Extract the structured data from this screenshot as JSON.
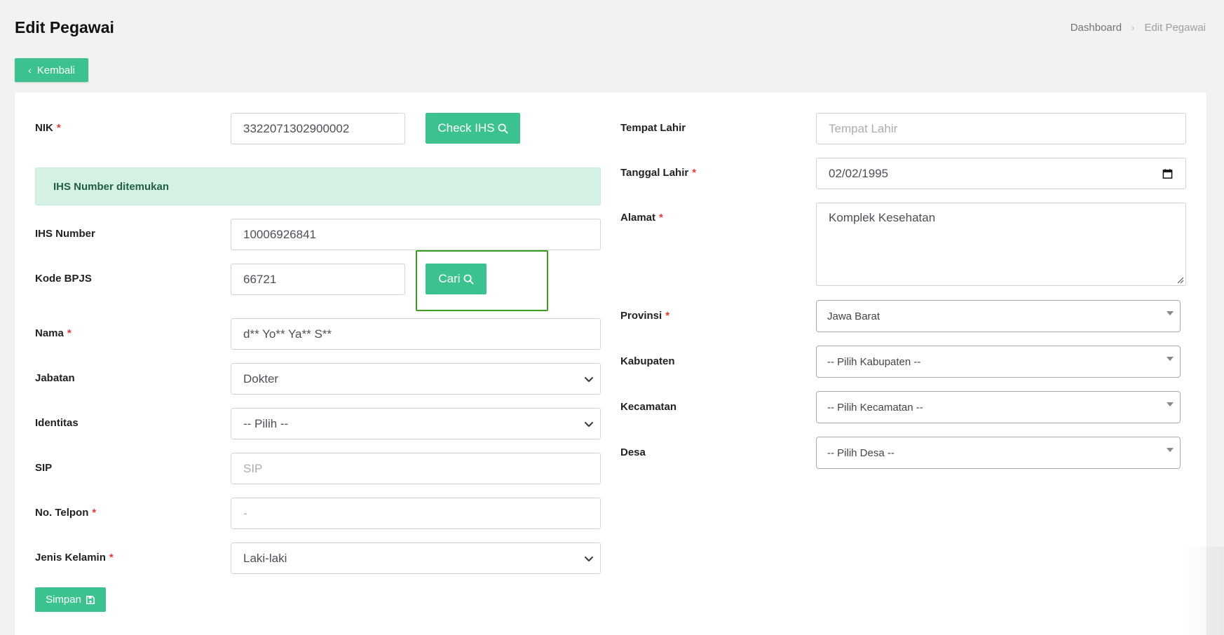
{
  "header": {
    "title": "Edit Pegawai",
    "breadcrumb": {
      "home": "Dashboard",
      "current": "Edit Pegawai"
    }
  },
  "back_button": {
    "label": "Kembali"
  },
  "left": {
    "nik": {
      "label": "NIK",
      "value": "3322071302900002"
    },
    "check_ihs_button": "Check IHS",
    "alert": "IHS Number ditemukan",
    "ihs_number": {
      "label": "IHS Number",
      "value": "10006926841"
    },
    "kode_bpjs": {
      "label": "Kode BPJS",
      "value": "66721"
    },
    "cari_button": "Cari",
    "nama": {
      "label": "Nama",
      "value": "d** Yo** Ya** S**"
    },
    "jabatan": {
      "label": "Jabatan",
      "value": "Dokter"
    },
    "identitas": {
      "label": "Identitas",
      "value": "-- Pilih --"
    },
    "sip": {
      "label": "SIP",
      "placeholder": "SIP"
    },
    "telpon": {
      "label": "No. Telpon",
      "value": "-"
    },
    "jenis_kelamin": {
      "label": "Jenis Kelamin",
      "value": "Laki-laki"
    },
    "simpan_button": "Simpan"
  },
  "right": {
    "tempat_lahir": {
      "label": "Tempat Lahir",
      "placeholder": "Tempat Lahir"
    },
    "tanggal_lahir": {
      "label": "Tanggal Lahir",
      "value": "02/02/1995"
    },
    "alamat": {
      "label": "Alamat",
      "value": "Komplek Kesehatan"
    },
    "provinsi": {
      "label": "Provinsi",
      "value": "Jawa Barat"
    },
    "kabupaten": {
      "label": "Kabupaten",
      "value": "-- Pilih Kabupaten --"
    },
    "kecamatan": {
      "label": "Kecamatan",
      "value": "-- Pilih Kecamatan --"
    },
    "desa": {
      "label": "Desa",
      "value": "-- Pilih Desa --"
    }
  },
  "required_mark": "*",
  "colors": {
    "primary": "#3cc28f",
    "alert_bg": "#d5f1e4",
    "highlight": "#3a9e1f",
    "required": "#e53935"
  }
}
